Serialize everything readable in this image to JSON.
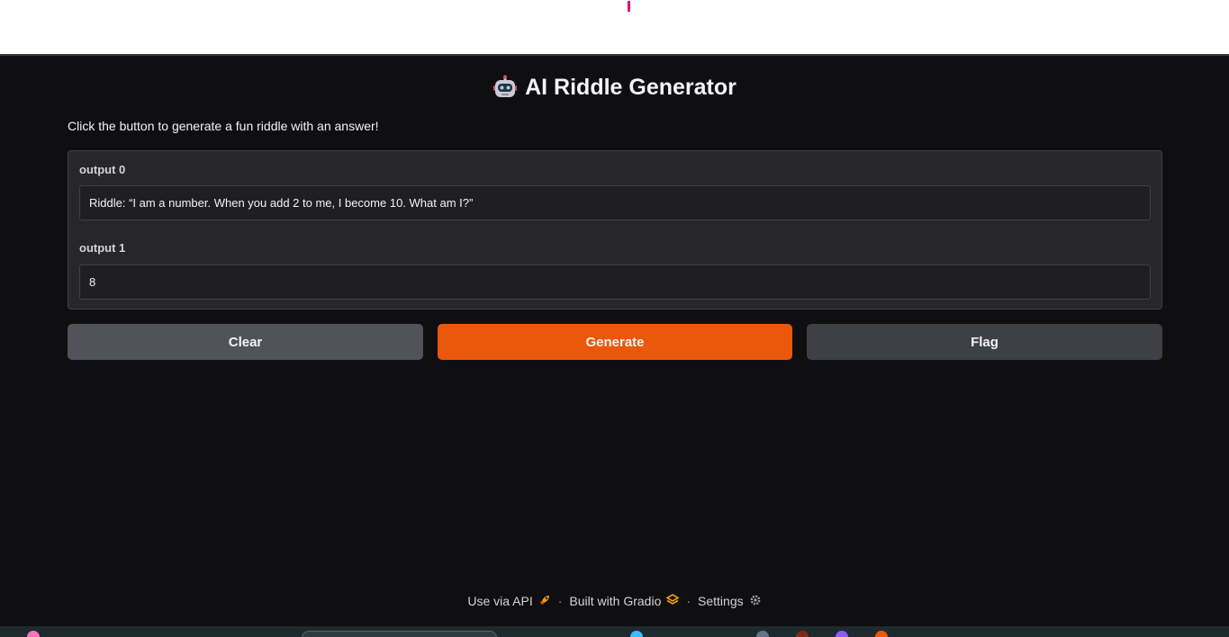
{
  "app": {
    "title": "AI Riddle Generator",
    "description": "Click the button to generate a fun riddle with an answer!"
  },
  "outputs": [
    {
      "label": "output 0",
      "value": "Riddle: “I am a number. When you add 2 to me, I become 10. What am I?”"
    },
    {
      "label": "output 1",
      "value": "8"
    }
  ],
  "buttons": {
    "clear": "Clear",
    "generate": "Generate",
    "flag": "Flag"
  },
  "footer": {
    "api": "Use via API",
    "built": "Built with Gradio",
    "settings": "Settings",
    "separator": "·"
  },
  "colors": {
    "accent": "#ea580c",
    "background": "#0f0f11",
    "panel": "#27272a"
  },
  "icons": {
    "title": "robot-icon",
    "api": "rocket-icon",
    "built": "gradio-logo-icon",
    "settings": "gear-icon"
  }
}
